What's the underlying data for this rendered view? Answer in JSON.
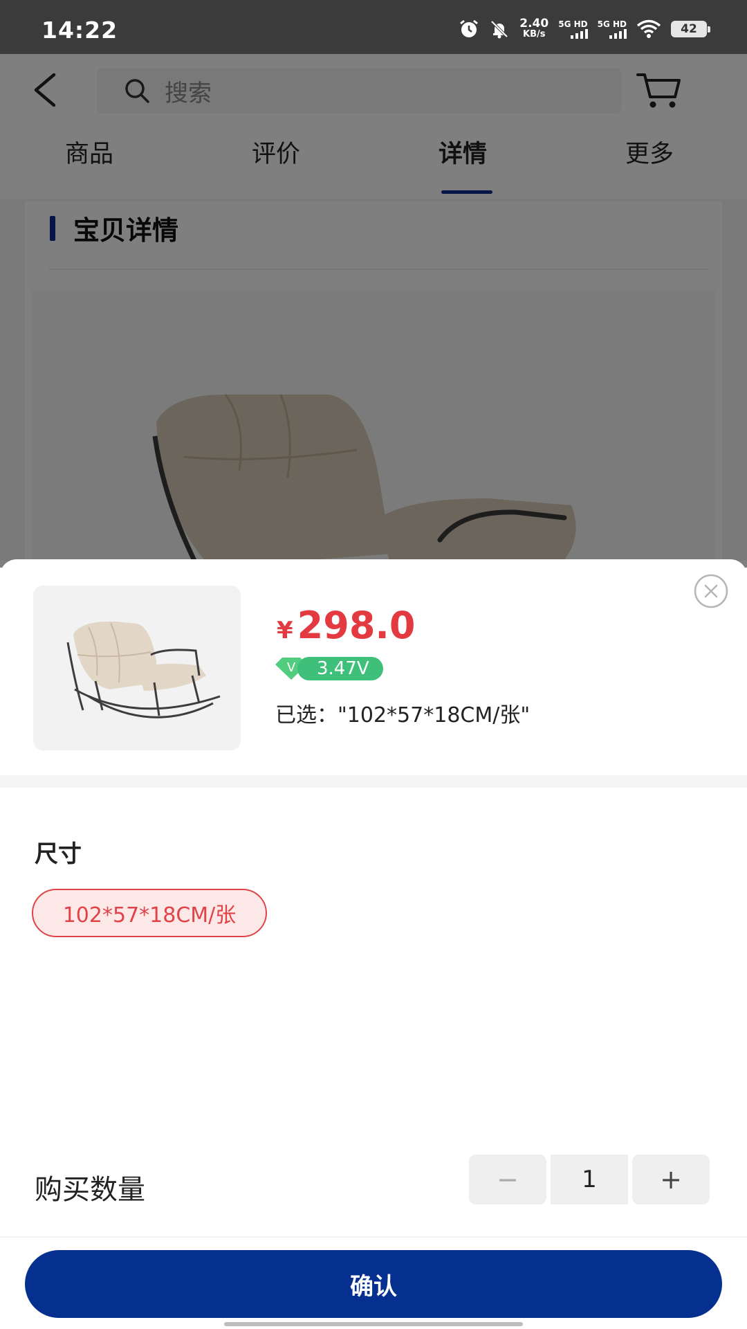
{
  "status_bar": {
    "time": "14:22",
    "net_speed_value": "2.40",
    "net_speed_unit": "KB/s",
    "sim1_label": "5G HD",
    "sim2_label": "5G HD",
    "battery": "42",
    "icons": [
      "alarm-icon",
      "mute-icon",
      "wifi-icon"
    ]
  },
  "header": {
    "search_placeholder": "搜索",
    "icons": [
      "back-icon",
      "search-icon",
      "cart-icon"
    ]
  },
  "tabs": [
    {
      "label": "商品",
      "active": false
    },
    {
      "label": "评价",
      "active": false
    },
    {
      "label": "详情",
      "active": true
    },
    {
      "label": "更多",
      "active": false
    }
  ],
  "details_section": {
    "title": "宝贝详情"
  },
  "sheet": {
    "price_symbol": "¥",
    "price": "298.0",
    "vip_icon": "V",
    "vip_value": "3.47V",
    "selected": "已选：\"102*57*18CM/张\"",
    "size_label": "尺寸",
    "size_options": [
      {
        "label": "102*57*18CM/张",
        "selected": true
      }
    ],
    "quantity_label": "购买数量",
    "quantity_minus": "−",
    "quantity_value": "1",
    "quantity_plus": "+",
    "confirm_label": "确认"
  },
  "colors": {
    "accent": "#05308f",
    "price": "#e23a40",
    "vip": "#3ec07a"
  }
}
